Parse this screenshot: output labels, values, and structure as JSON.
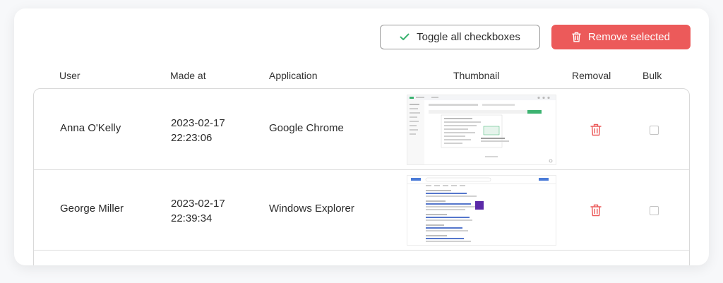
{
  "toolbar": {
    "toggle_label": "Toggle all checkboxes",
    "toggle_icon": "check-icon",
    "remove_label": "Remove selected",
    "remove_icon": "trash-icon",
    "remove_color": "#ec5a5a",
    "check_color": "#3cb371"
  },
  "columns": {
    "user": "User",
    "made_at": "Made at",
    "application": "Application",
    "thumbnail": "Thumbnail",
    "removal": "Removal",
    "bulk": "Bulk"
  },
  "rows": [
    {
      "user": "Anna O'Kelly",
      "date": "2023-02-17",
      "time": "22:23:06",
      "application": "Google Chrome",
      "thumbnail_icon": "screenshot-thumbnail",
      "removal_icon": "trash-icon",
      "checked": false
    },
    {
      "user": "George Miller",
      "date": "2023-02-17",
      "time": "22:39:34",
      "application": "Windows Explorer",
      "thumbnail_icon": "screenshot-thumbnail",
      "removal_icon": "trash-icon",
      "checked": false
    }
  ]
}
